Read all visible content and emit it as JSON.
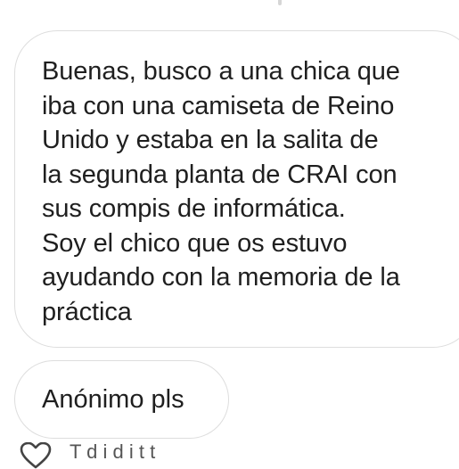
{
  "conversation": {
    "messages": [
      {
        "text": "Buenas, busco a una chica que\niba con una camiseta de Reino\nUnido y estaba en la salita de\nla segunda planta de CRAI con\nsus compis de informática.\nSoy el chico que os estuvo\nayudando con la memoria de la\npráctica"
      },
      {
        "text": "Anónimo pls"
      }
    ],
    "footer": {
      "icon": "heart-icon",
      "text": "T         d                        i  d i               t                 t"
    }
  },
  "colors": {
    "background": "#ffffff",
    "bubble_border": "#dddddd",
    "text": "#1f1f1f"
  }
}
